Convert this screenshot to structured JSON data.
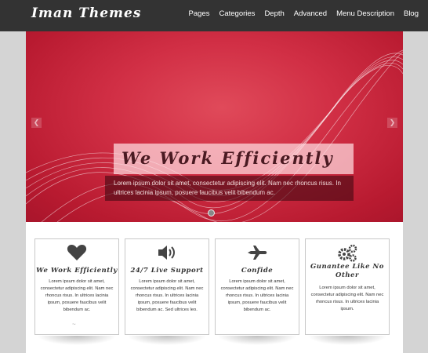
{
  "brand": {
    "logo": "Iman Themes"
  },
  "nav": [
    "Pages",
    "Categories",
    "Depth",
    "Advanced",
    "Menu Description",
    "Blog"
  ],
  "slider": {
    "caption_title": "We Work Efficiently",
    "caption_text": "Lorem ipsum dolor sit amet, consectetur adipiscing elit. Nam nec rhoncus risus. In ultrices lacinia ipsum, posuere faucibus velit bibendum ac.",
    "prev_icon": "chevron-left-icon",
    "next_icon": "chevron-right-icon",
    "colors": {
      "bg": "#d12f45",
      "caption_title_bg": "#f6d8dc",
      "caption_text_bg": "#461018"
    }
  },
  "features": [
    {
      "icon": "heart-icon",
      "title": "We Work Efficiently",
      "text": "Lorem ipsum dolor sit amet, consectetur adipiscing elit. Nam nec rhoncus risus. In ultrices lacinia ipsum, posuere faucibus velit bibendum ac."
    },
    {
      "icon": "speaker-icon",
      "title": "24/7 Live Support",
      "text": "Lorem ipsum dolor sit amet, consectetur adipiscing elit. Nam nec rhoncus risus. In ultrices lacinia ipsum, posuere faucibus velit bibendum ac. Sed ultrices leo."
    },
    {
      "icon": "airplane-icon",
      "title": "Confide",
      "text": "Lorem ipsum dolor sit amet, consectetur adipiscing elit. Nam nec rhoncus risus. In ultrices lacinia ipsum, posuere faucibus velit bibendum ac."
    },
    {
      "icon": "gears-icon",
      "title": "Gunantee Like No Other",
      "text": "Lorem ipsum dolor sit amet, consectetur adipiscing elit. Nam nec rhoncus risus. In ultrices lacinia ipsum."
    }
  ]
}
